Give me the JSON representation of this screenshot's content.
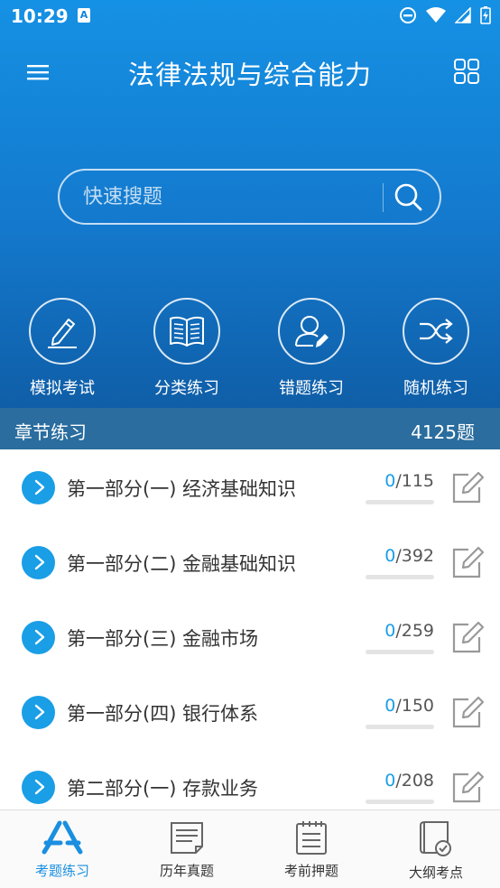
{
  "status": {
    "time": "10:29",
    "notification_badge": "A"
  },
  "toolbar": {
    "title": "法律法规与综合能力"
  },
  "search": {
    "placeholder": "快速搜题"
  },
  "features": [
    {
      "label": "模拟考试",
      "icon": "pen-icon"
    },
    {
      "label": "分类练习",
      "icon": "book-icon"
    },
    {
      "label": "错题练习",
      "icon": "user-edit-icon"
    },
    {
      "label": "随机练习",
      "icon": "shuffle-icon"
    }
  ],
  "section": {
    "title": "章节练习",
    "count": "4125题"
  },
  "chapters": [
    {
      "name": "第一部分(一) 经济基础知识",
      "done": "0",
      "total": "/115"
    },
    {
      "name": "第一部分(二) 金融基础知识",
      "done": "0",
      "total": "/392"
    },
    {
      "name": "第一部分(三) 金融市场",
      "done": "0",
      "total": "/259"
    },
    {
      "name": "第一部分(四) 银行体系",
      "done": "0",
      "total": "/150"
    },
    {
      "name": "第二部分(一) 存款业务",
      "done": "0",
      "total": "/208"
    }
  ],
  "tabs": [
    {
      "label": "考题练习",
      "active": true
    },
    {
      "label": "历年真题",
      "active": false
    },
    {
      "label": "考前押题",
      "active": false
    },
    {
      "label": "大纲考点",
      "active": false
    }
  ],
  "colors": {
    "accent": "#1a9ee6",
    "header_bar": "#2a6d9e",
    "hero_top": "#1591e4",
    "hero_bottom": "#0f5ea7"
  }
}
